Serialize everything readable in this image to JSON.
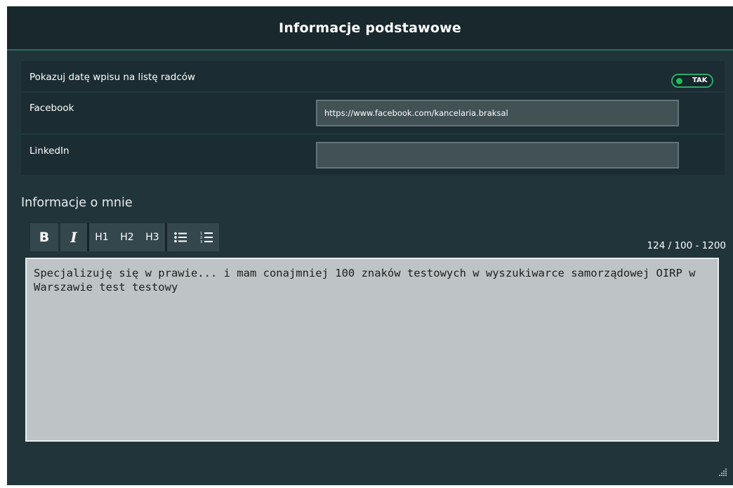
{
  "header": {
    "title": "Informacje podstawowe"
  },
  "settings": {
    "show_date": {
      "label": "Pokazuj datę wpisu na listę radców",
      "toggle_text": "TAK",
      "toggle_on": true
    },
    "facebook": {
      "label": "Facebook",
      "value": "https://www.facebook.com/kancelaria.braksal"
    },
    "linkedin": {
      "label": "LinkedIn",
      "value": ""
    }
  },
  "about": {
    "title": "Informacje o mnie",
    "toolbar": {
      "bold": "B",
      "italic": "I",
      "h1": "H1",
      "h2": "H2",
      "h3": "H3",
      "bullet_icon": "bulleted-list-icon",
      "numbered_icon": "numbered-list-icon"
    },
    "counter": "124 / 100 - 1200",
    "content": "Specjalizuję się w prawie... i mam conajmniej 100 znaków testowych w wyszukiwarce samorządowej OIRP w Warszawie test testowy"
  },
  "colors": {
    "background": "#21343a",
    "header_bg": "#18282d",
    "accent": "#2fa86b",
    "toggle_dot": "#1fbd56",
    "editor_bg": "#bec4c5"
  }
}
